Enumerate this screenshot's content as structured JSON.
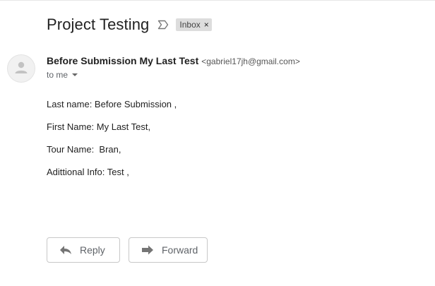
{
  "email": {
    "subject": "Project Testing",
    "importance_icon": "importance-marker-icon",
    "label": "Inbox",
    "label_close": "×",
    "sender_name": "Before Submission My Last Test",
    "sender_email": "<gabriel17jh@gmail.com>",
    "recipient": "to me",
    "avatar_icon": "person-icon",
    "body_lines": [
      "Last name: Before Submission ,",
      "First Name: My Last Test,",
      "Tour Name:  Bran,",
      "Adittional Info: Test ,"
    ]
  },
  "actions": {
    "reply_label": "Reply",
    "forward_label": "Forward",
    "reply_icon": "reply-arrow-icon",
    "forward_icon": "forward-arrow-icon"
  },
  "colors": {
    "label_chip_bg": "#dddddd",
    "button_border": "#c8c8c8",
    "icon_gray": "#757575"
  }
}
